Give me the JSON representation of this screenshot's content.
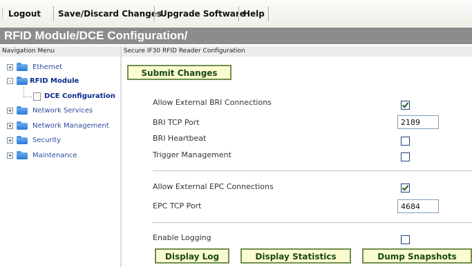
{
  "toolbar": {
    "items": [
      {
        "label": "Logout"
      },
      {
        "label": "Save/Discard Changes"
      },
      {
        "label": "Upgrade Software"
      },
      {
        "label": "Help"
      }
    ]
  },
  "page": {
    "title": "RFID Module/DCE Configuration/"
  },
  "nav": {
    "header": "Navigation Menu",
    "items": [
      {
        "label": "Ethernet",
        "expander": "+"
      },
      {
        "label": "RFID Module",
        "expander": "-"
      },
      {
        "label": "DCE Configuration"
      },
      {
        "label": "Network Services",
        "expander": "+"
      },
      {
        "label": "Network Management",
        "expander": "+"
      },
      {
        "label": "Security",
        "expander": "+"
      },
      {
        "label": "Maintenance",
        "expander": "+"
      }
    ]
  },
  "main": {
    "header": "Secure IF30 RFID Reader Configuration",
    "submit_label": "Submit Changes",
    "fields": {
      "allow_bri": {
        "label": "Allow External BRI Connections",
        "checked": true
      },
      "bri_port": {
        "label": "BRI TCP Port",
        "value": "2189"
      },
      "bri_heartbeat": {
        "label": "BRI Heartbeat",
        "checked": false
      },
      "trigger_mgmt": {
        "label": "Trigger Management",
        "checked": false
      },
      "allow_epc": {
        "label": "Allow External EPC Connections",
        "checked": true
      },
      "epc_port": {
        "label": "EPC TCP Port",
        "value": "4684"
      },
      "enable_logging": {
        "label": "Enable Logging",
        "checked": false
      }
    },
    "actions": {
      "display_log": "Display Log",
      "display_statistics": "Display Statistics",
      "dump_snapshots": "Dump Snapshots"
    }
  }
}
